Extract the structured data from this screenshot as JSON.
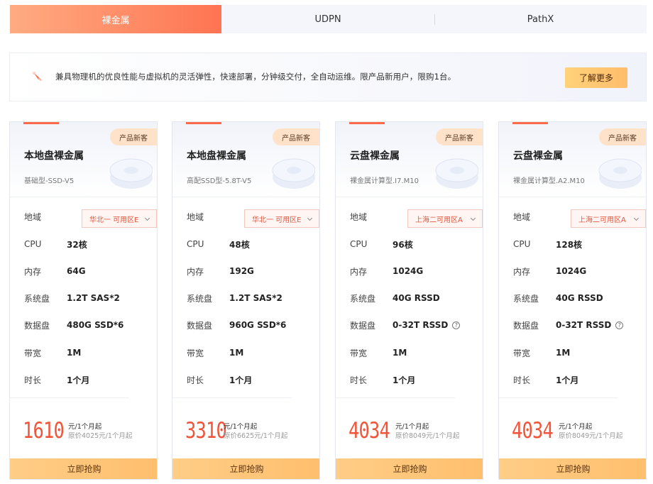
{
  "tabs": [
    {
      "label": "裸金属",
      "active": true
    },
    {
      "label": "UDPN",
      "active": false
    },
    {
      "label": "PathX",
      "active": false
    }
  ],
  "banner": {
    "icon": "rocket-icon",
    "text": "兼具物理机的优良性能与虚拟机的灵活弹性，快速部署，分钟级交付，全自动运维。限产品新用户，限购1台。",
    "button": "了解更多"
  },
  "spec_labels": {
    "region": "地域",
    "cpu": "CPU",
    "memory": "内存",
    "system_disk": "系统盘",
    "data_disk": "数据盘",
    "bandwidth": "带宽",
    "duration": "时长"
  },
  "cards": [
    {
      "badge": "产品新客",
      "title": "本地盘裸金属",
      "subtitle": "基础型-SSD-V5",
      "region": "华北一 可用区E",
      "cpu": "32核",
      "memory": "64G",
      "system_disk": "1.2T SAS*2",
      "data_disk": "480G SSD*6",
      "bandwidth": "1M",
      "duration": "1个月",
      "price": "1610",
      "price_unit": "元/1个月起",
      "original_price": "原价4025元/1个月起",
      "buy": "立即抢购"
    },
    {
      "badge": "产品新客",
      "title": "本地盘裸金属",
      "subtitle": "高配SSD型-5.8T-V5",
      "region": "华北一 可用区E",
      "cpu": "48核",
      "memory": "192G",
      "system_disk": "1.2T SAS*2",
      "data_disk": "960G SSD*6",
      "bandwidth": "1M",
      "duration": "1个月",
      "price": "3310",
      "price_unit": "元/1个月起",
      "original_price": "原价6625元/1个月起",
      "buy": "立即抢购"
    },
    {
      "badge": "产品新客",
      "title": "云盘裸金属",
      "subtitle": "裸金属计算型.I7.M10",
      "region": "上海二可用区A",
      "cpu": "96核",
      "memory": "1024G",
      "system_disk": "40G RSSD",
      "data_disk": "0-32T RSSD",
      "bandwidth": "1M",
      "duration": "1个月",
      "price": "4034",
      "price_unit": "元/1个月起",
      "original_price": "原价8049元/1个月起",
      "buy": "立即抢购"
    },
    {
      "badge": "产品新客",
      "title": "云盘裸金属",
      "subtitle": "裸金属计算型.A2.M10",
      "region": "上海二可用区A",
      "cpu": "128核",
      "memory": "1024G",
      "system_disk": "40G RSSD",
      "data_disk": "0-32T RSSD",
      "bandwidth": "1M",
      "duration": "1个月",
      "price": "4034",
      "price_unit": "元/1个月起",
      "original_price": "原价8049元/1个月起",
      "buy": "立即抢购"
    }
  ],
  "colors": {
    "accent": "#ff6b4a",
    "price": "#f0553b",
    "button": "#ffc57a",
    "badge": "#ffe2c7"
  }
}
